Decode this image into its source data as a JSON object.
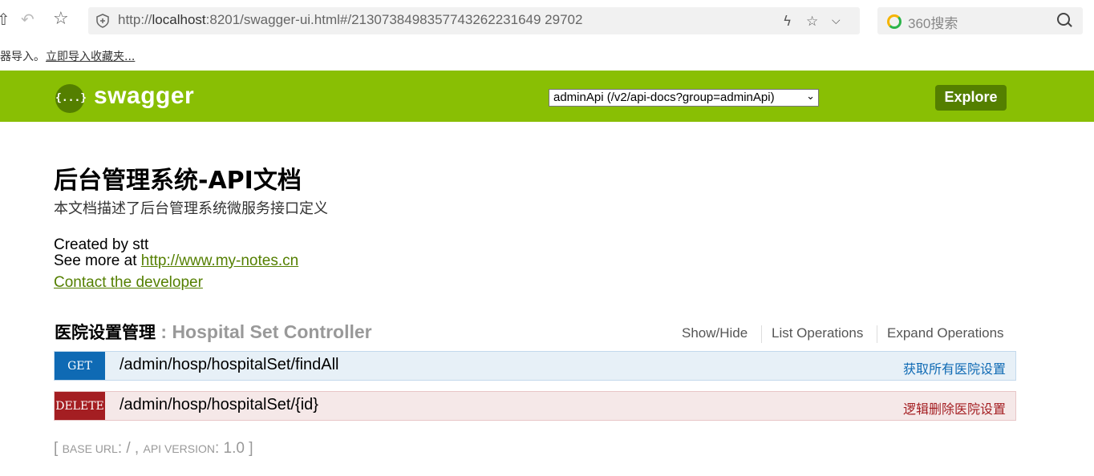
{
  "browser": {
    "url_prefix": "http://",
    "url_host": "localhost",
    "url_rest": ":8201/swagger-ui.html#/2130738498357743262231649 29702",
    "search_placeholder": "360搜索"
  },
  "bookmarks": {
    "notice": "器导入。",
    "import_link": "立即导入收藏夹..."
  },
  "header": {
    "logo_glyph": "{...}",
    "logo_text": "swagger",
    "api_select": "adminApi (/v2/api-docs?group=adminApi)",
    "explore_label": "Explore"
  },
  "info": {
    "title": "后台管理系统-API文档",
    "description": "本文档描述了后台管理系统微服务接口定义",
    "created_by": "Created by stt",
    "see_more_prefix": "See more at ",
    "see_more_link": "http://www.my-notes.cn",
    "contact": "Contact the developer"
  },
  "resource": {
    "name_cn": "医院设置管理",
    "name_en": " : Hospital Set Controller",
    "show_hide": "Show/Hide",
    "list_ops": "List Operations",
    "expand_ops": "Expand Operations"
  },
  "operations": [
    {
      "method": "GET",
      "path": "/admin/hosp/hospitalSet/findAll",
      "summary": "获取所有医院设置"
    },
    {
      "method": "DELETE",
      "path": "/admin/hosp/hospitalSet/{id}",
      "summary": "逻辑删除医院设置"
    }
  ],
  "footer": {
    "open": "[ ",
    "base_url_label": "BASE URL",
    "base_url_value": ": / , ",
    "api_version_label": "API VERSION",
    "api_version_value": ": 1.0 ]"
  },
  "colors": {
    "header_green": "#89bf04",
    "dark_green": "#547f00",
    "get_blue": "#0f6ab4",
    "delete_red": "#a41e22"
  }
}
